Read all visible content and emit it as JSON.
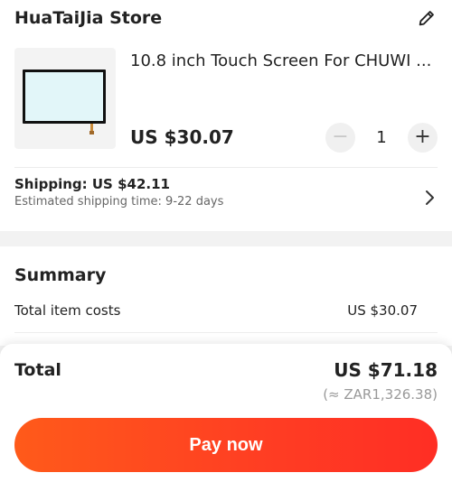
{
  "store": {
    "name": "HuaTaiJia Store",
    "edit_icon": "pencil-icon"
  },
  "product": {
    "title": "10.8 inch Touch Screen For CHUWI ...",
    "price": "US $30.07",
    "quantity": "1",
    "minus": "−",
    "plus": "+"
  },
  "shipping": {
    "title": "Shipping: US $42.11",
    "estimate": "Estimated shipping time: 9-22 days"
  },
  "summary": {
    "title": "Summary",
    "item_costs_label": "Total item costs",
    "item_costs_value": "US $30.07"
  },
  "footer": {
    "total_label": "Total",
    "total_value": "US $71.18",
    "total_converted": "(≈ ZAR1,326.38)",
    "pay_button": "Pay now"
  },
  "colors": {
    "accent": "#ff3d23"
  }
}
